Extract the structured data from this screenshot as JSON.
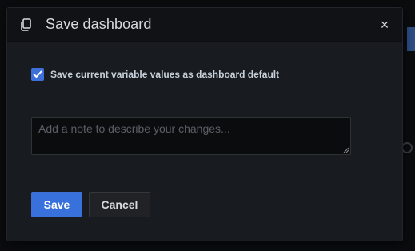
{
  "dialog": {
    "title": "Save dashboard",
    "icon": "copy-icon",
    "close_label": "×"
  },
  "options": {
    "save_variables_label": "Save current variable values as dashboard default",
    "save_variables_checked": true
  },
  "note": {
    "placeholder": "Add a note to describe your changes...",
    "value": ""
  },
  "actions": {
    "save_label": "Save",
    "cancel_label": "Cancel"
  },
  "colors": {
    "accent": "#3871dc",
    "background": "#181b1f",
    "header": "#111216"
  }
}
